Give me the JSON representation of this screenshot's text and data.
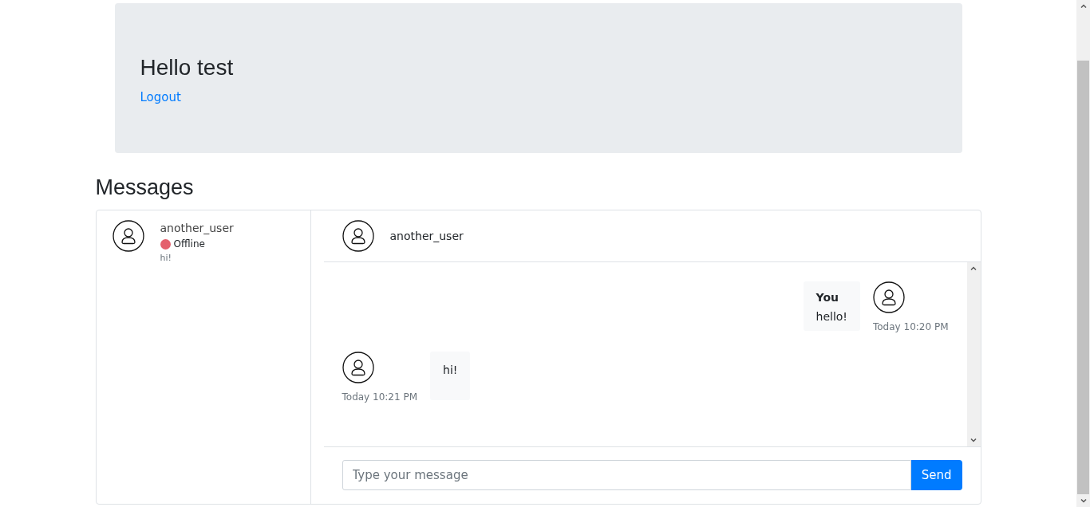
{
  "header": {
    "greeting": "Hello test",
    "logout": "Logout"
  },
  "heading": "Messages",
  "contacts": [
    {
      "name": "another_user",
      "status": "Offline",
      "color": "#e4606d",
      "preview": "hi!",
      "selected": false
    }
  ],
  "chat": {
    "title": "another_user",
    "messages": [
      {
        "kind": "sent",
        "sender": "You",
        "text": "hello!",
        "time": "Today 10:20 PM"
      },
      {
        "kind": "received",
        "text": "hi!",
        "time": "Today 10:21 PM"
      }
    ],
    "input": {
      "placeholder": "Type your message"
    },
    "send": "Send"
  }
}
